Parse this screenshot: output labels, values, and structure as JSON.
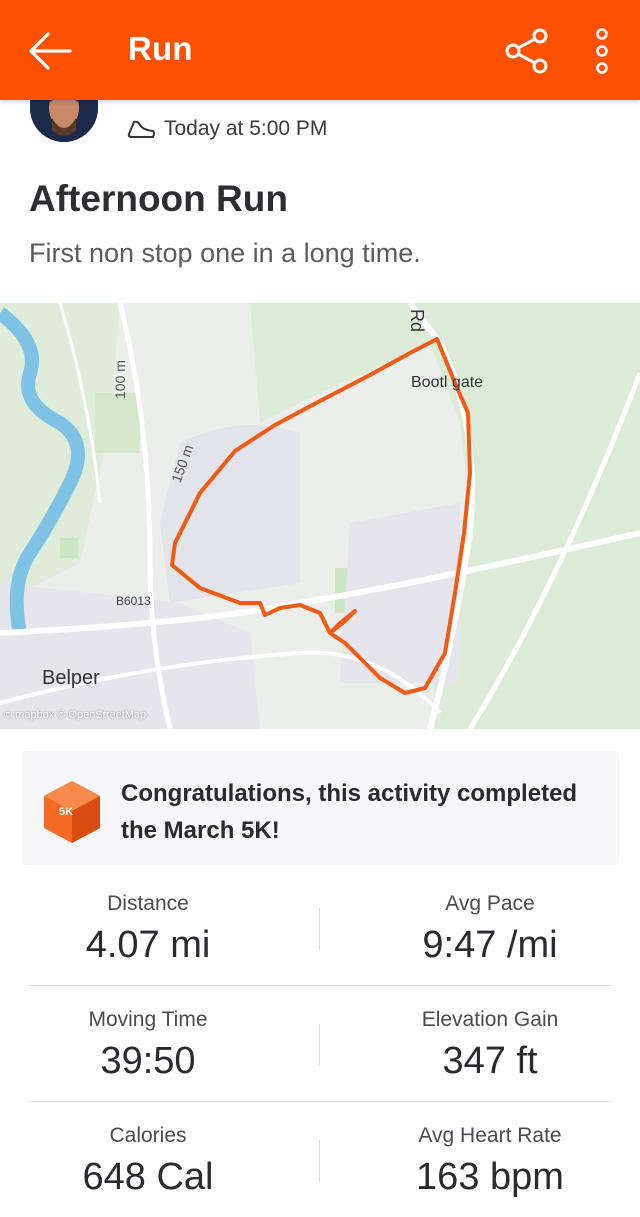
{
  "appbar": {
    "title": "Run",
    "back_icon": "arrow-left-icon",
    "share_icon": "share-icon",
    "more_icon": "more-vertical-icon",
    "color": "#fc5200"
  },
  "activity": {
    "date_time": "Today at 5:00 PM",
    "title": "Afternoon Run",
    "description": "First non stop one in a long time."
  },
  "map": {
    "labels": {
      "road_rd": "Rd",
      "bottle_gate": "Bootl gate",
      "contour_100": "100 m",
      "contour_150": "150 m",
      "road_b6013": "B6013",
      "town": "Belper",
      "attribution": "© mapbox © OpenStreetMap"
    },
    "route_color": "#f25a14"
  },
  "challenge": {
    "badge_label": "5K",
    "message": "Congratulations, this activity completed the March 5K!"
  },
  "stats": [
    {
      "left": {
        "label": "Distance",
        "value": "4.07 mi"
      },
      "right": {
        "label": "Avg Pace",
        "value": "9:47 /mi"
      }
    },
    {
      "left": {
        "label": "Moving Time",
        "value": "39:50"
      },
      "right": {
        "label": "Elevation Gain",
        "value": "347 ft"
      }
    },
    {
      "left": {
        "label": "Calories",
        "value": "648 Cal"
      },
      "right": {
        "label": "Avg Heart Rate",
        "value": "163 bpm"
      }
    }
  ]
}
